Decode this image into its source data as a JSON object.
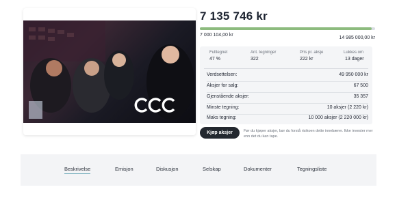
{
  "campaign": {
    "amount_raised": "7 135 746 kr",
    "progress_fraction": 0.98,
    "min_amount": "7 000 104,00 kr",
    "max_amount": "14 985 000,00 kr"
  },
  "stats": {
    "headers": [
      "Fulltegnet",
      "Ant. tegninger",
      "Pris pr. aksje",
      "Lukkes om"
    ],
    "values": [
      "47 %",
      "322",
      "222 kr",
      "13 dager"
    ]
  },
  "details": [
    {
      "label": "Verdsettelsen:",
      "value": "49 950 000 kr"
    },
    {
      "label": "Aksjer for salg:",
      "value": "67 500"
    },
    {
      "label": "Gjenstående aksjer:",
      "value": "35 357"
    },
    {
      "label": "Minste tegning:",
      "value": "10 aksjer (2 220 kr)"
    },
    {
      "label": "Maks tegning:",
      "value": "10 000 aksjer (2 220 000 kr)"
    }
  ],
  "buy": {
    "button_label": "Kjøp aksjer",
    "note": "Før du kjøper aksjer, bør du forstå risikoen dette innebærer. Ikke invester mer enn det du kan tape."
  },
  "tabs": [
    "Beskrivelse",
    "Emisjon",
    "Diskusjon",
    "Selskap",
    "Dokumenter",
    "Tegningsliste"
  ],
  "colors": {
    "progress": "#8dbb7e",
    "button": "#23282f",
    "active_tab": "#5b9fb0"
  }
}
